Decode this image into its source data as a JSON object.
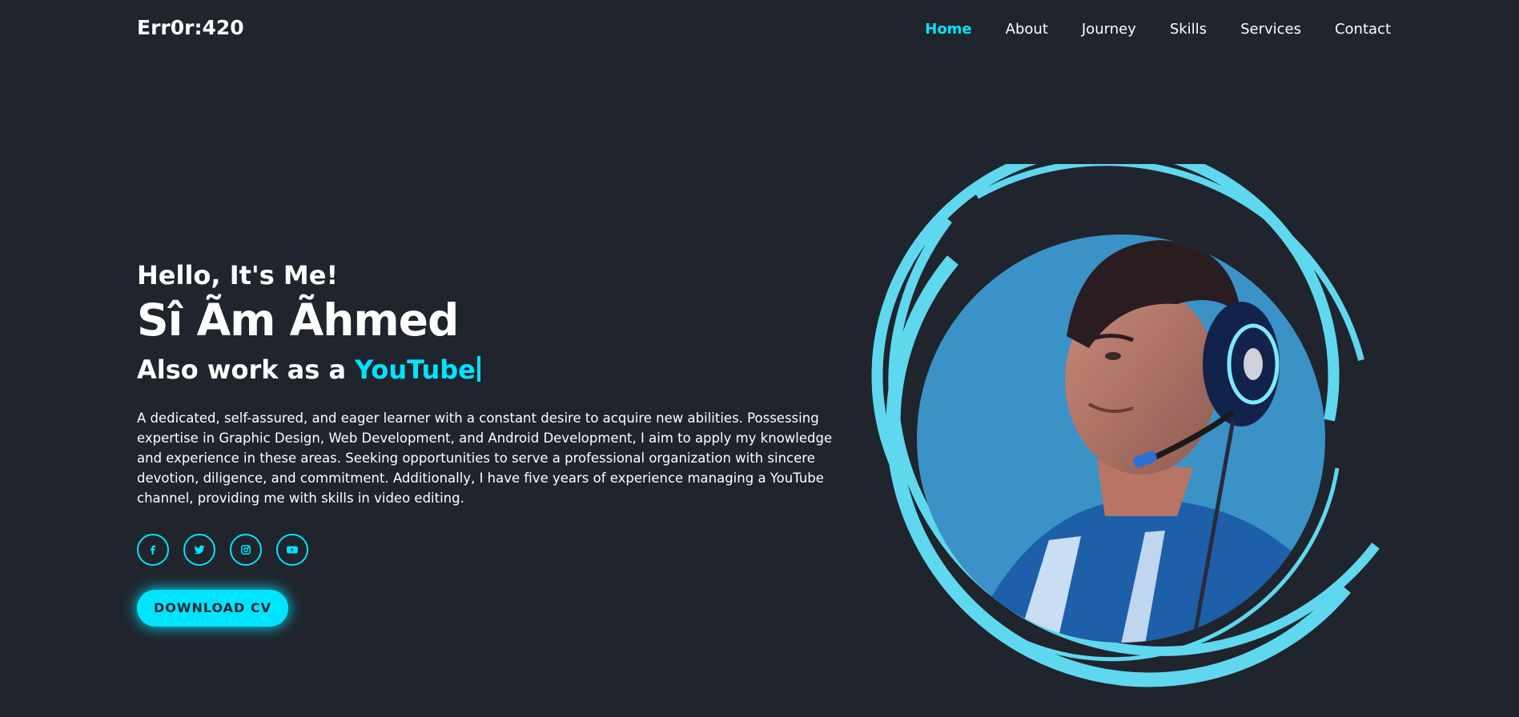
{
  "header": {
    "logo": "Err0r:420",
    "nav": [
      {
        "label": "Home",
        "active": true
      },
      {
        "label": "About",
        "active": false
      },
      {
        "label": "Journey",
        "active": false
      },
      {
        "label": "Skills",
        "active": false
      },
      {
        "label": "Services",
        "active": false
      },
      {
        "label": "Contact",
        "active": false
      }
    ]
  },
  "hero": {
    "greeting": "Hello, It's Me!",
    "name": "Sî Ãm Ãhmed",
    "role_prefix": "Also work as a",
    "role_typed": "YouTube",
    "description": "A dedicated, self-assured, and eager learner with a constant desire to acquire new abilities. Possessing expertise in Graphic Design, Web Development, and Android Development, I aim to apply my knowledge and experience in these areas. Seeking opportunities to serve a professional organization with sincere devotion, diligence, and commitment. Additionally, I have five years of experience managing a YouTube channel, providing me with skills in video editing.",
    "socials": [
      "facebook-icon",
      "twitter-icon",
      "instagram-icon",
      "youtube-icon"
    ],
    "cta_label": "DOWNLOAD CV"
  },
  "colors": {
    "background": "#1f242d",
    "accent": "#00e5ff",
    "ring": "#5fd8ef",
    "photo_bg": "#3b92c6"
  }
}
